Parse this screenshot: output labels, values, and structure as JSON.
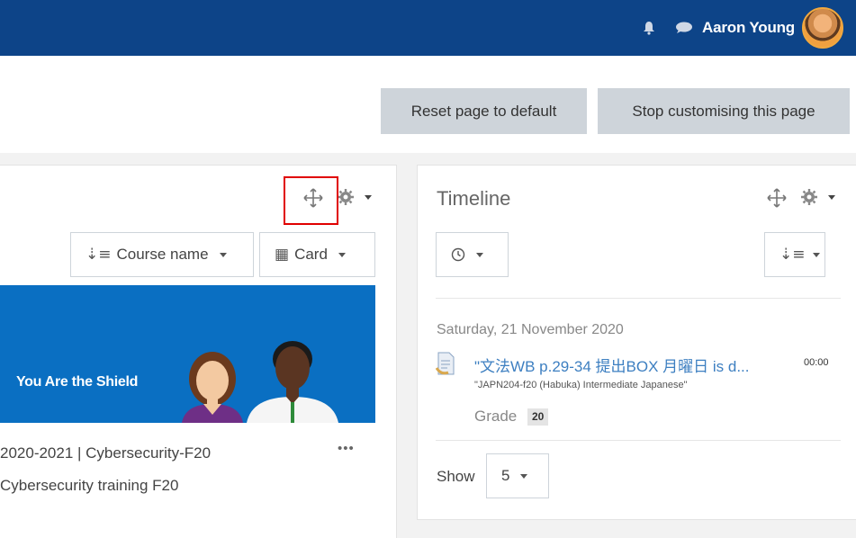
{
  "navbar": {
    "user_name": "Aaron Young",
    "icons": [
      "bell-icon",
      "chat-icon",
      "user-avatar"
    ],
    "background": "#0d4488"
  },
  "page_actions": {
    "reset_label": "Reset page to default",
    "stop_label": "Stop customising this page"
  },
  "course_overview": {
    "sort_label": "Course name",
    "view_label": "Card",
    "banner_text": "You Are the Shield",
    "course_title": "2020-2021 | Cybersecurity-F20",
    "course_subtitle": "Cybersecurity training F20",
    "more_label": "•••"
  },
  "timeline": {
    "title": "Timeline",
    "date_heading": "Saturday, 21 November 2020",
    "event_name": "\"文法WB p.29-34 提出BOX 月曜日 is d...",
    "event_time": "00:00",
    "event_course": "\"JAPN204-f20 (Habuka) Intermediate Japanese\"",
    "grade_label": "Grade",
    "grade_value": "20",
    "show_label": "Show",
    "show_value": "5"
  },
  "highlight": {
    "color": "#e00000",
    "target": "move-icon"
  }
}
